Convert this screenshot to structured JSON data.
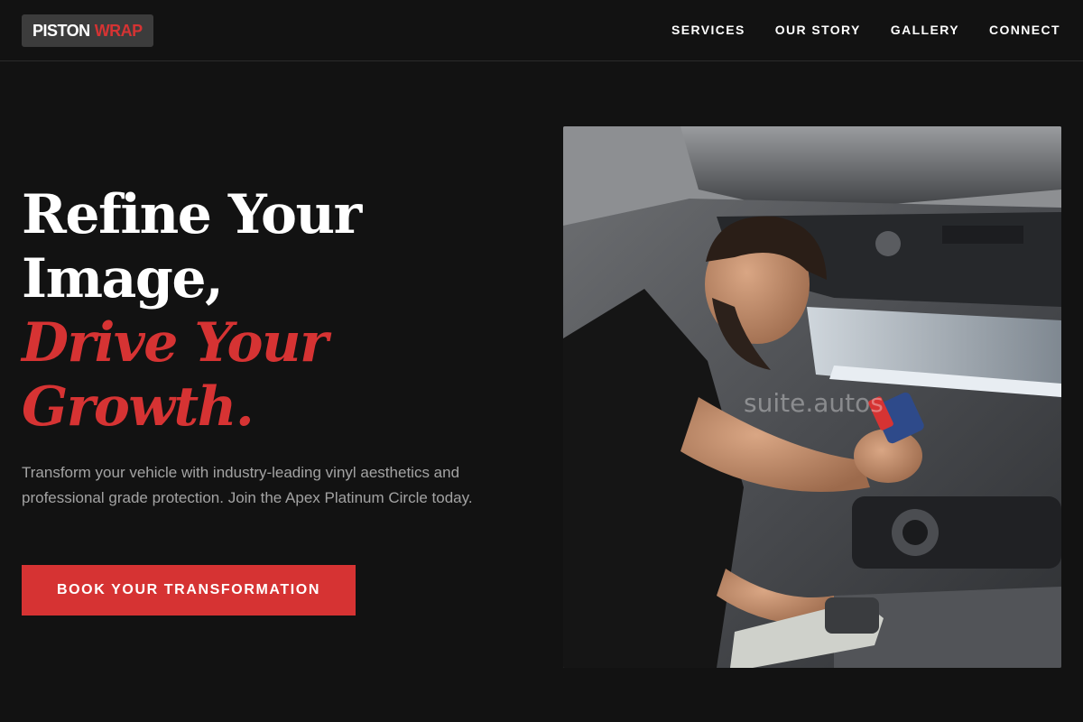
{
  "brand": {
    "word1": "PISTON",
    "word2": "WRAP",
    "accent": "#d63333"
  },
  "nav": {
    "items": [
      {
        "label": "SERVICES"
      },
      {
        "label": "OUR STORY"
      },
      {
        "label": "GALLERY"
      },
      {
        "label": "CONNECT"
      }
    ]
  },
  "hero": {
    "headline_lines": [
      "Refine Your",
      "Image,"
    ],
    "accent_lines": [
      "Drive Your",
      "Growth."
    ],
    "subtitle": "Transform your vehicle with industry-leading vinyl aesthetics and professional grade protection. Join the Apex Platinum Circle today.",
    "cta_label": "BOOK YOUR TRANSFORMATION",
    "image_watermark": "suite.autos"
  },
  "colors": {
    "background": "#121212",
    "accent": "#d63333",
    "muted_text": "#a3a3a3",
    "logo_bg": "#3c3c3c"
  }
}
